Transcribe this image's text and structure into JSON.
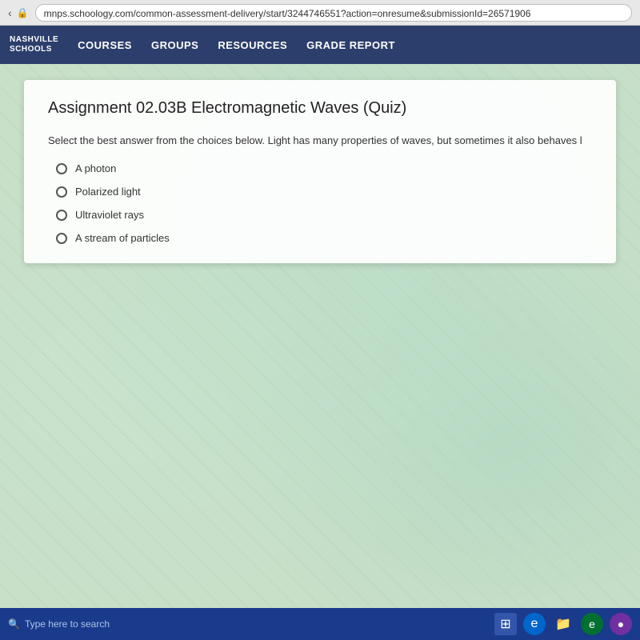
{
  "browser": {
    "url": "mnps.schoology.com/common-assessment-delivery/start/3244746551?action=onresume&submissionId=26571906"
  },
  "nav": {
    "logo_line1": "NASHVILLE",
    "logo_line2": "SCHOOLS",
    "items": [
      {
        "label": "COURSES",
        "id": "courses"
      },
      {
        "label": "GROUPS",
        "id": "groups"
      },
      {
        "label": "RESOURCES",
        "id": "resources"
      },
      {
        "label": "GRADE REPORT",
        "id": "grade-report"
      }
    ]
  },
  "quiz": {
    "title": "Assignment 02.03B Electromagnetic Waves (Quiz)",
    "question": "Select the best answer from the choices below. Light has many properties of waves, but sometimes it also behaves l",
    "options": [
      {
        "label": "A photon",
        "id": "opt-a"
      },
      {
        "label": "Polarized light",
        "id": "opt-b"
      },
      {
        "label": "Ultraviolet rays",
        "id": "opt-c"
      },
      {
        "label": "A stream of particles",
        "id": "opt-d"
      }
    ]
  },
  "taskbar": {
    "search_placeholder": "Type here to search"
  }
}
